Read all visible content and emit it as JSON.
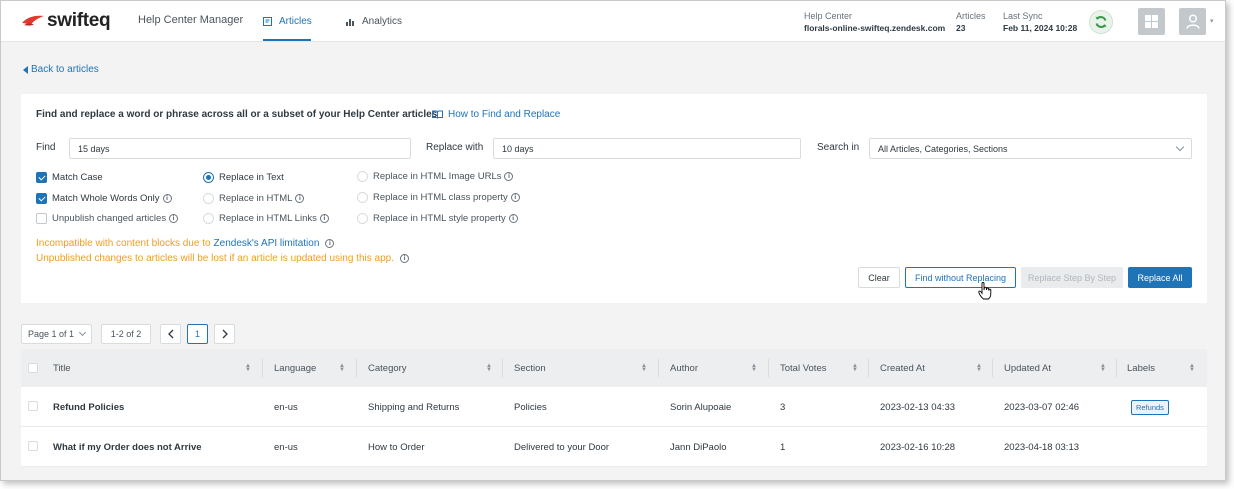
{
  "header": {
    "brand": "swifteq",
    "app_title": "Help Center Manager",
    "tabs": [
      {
        "label": "Articles",
        "icon": "article-icon",
        "active": true
      },
      {
        "label": "Analytics",
        "icon": "bar-chart-icon",
        "active": false
      }
    ],
    "help_center_label": "Help Center",
    "help_center_value": "florals-online-swifteq.zendesk.com",
    "articles_label": "Articles",
    "articles_value": "23",
    "last_sync_label": "Last Sync",
    "last_sync_value": "Feb 11, 2024 10:28"
  },
  "back_link": "Back to articles",
  "panel": {
    "heading": "Find and replace a word or phrase across all or a subset of your Help Center articles",
    "how_to_link": "How to Find and Replace",
    "find_label": "Find",
    "find_value": "15 days",
    "replace_label": "Replace with",
    "replace_value": "10 days",
    "search_in_label": "Search in",
    "search_in_value": "All Articles, Categories, Sections",
    "checkboxes": [
      {
        "label": "Match Case",
        "checked": true
      },
      {
        "label": "Match Whole Words Only",
        "checked": true
      },
      {
        "label": "Unpublish changed articles",
        "checked": false
      }
    ],
    "radios_col1": [
      {
        "label": "Replace in Text",
        "selected": true
      },
      {
        "label": "Replace in HTML",
        "selected": false
      },
      {
        "label": "Replace in HTML Links",
        "selected": false
      }
    ],
    "radios_col2": [
      {
        "label": "Replace in HTML Image URLs",
        "selected": false
      },
      {
        "label": "Replace in HTML class property",
        "selected": false
      },
      {
        "label": "Replace in HTML style property",
        "selected": false
      }
    ],
    "warning1_prefix": "Incompatible with content blocks due to",
    "warning1_link": "Zendesk's API limitation",
    "warning2": "Unpublished changes to articles will be lost if an article is updated using this app.",
    "buttons": {
      "clear": "Clear",
      "find_without_replacing": "Find without Replacing",
      "replace_step": "Replace Step By Step",
      "replace_all": "Replace All"
    }
  },
  "pagination": {
    "page_select": "Page 1 of 1",
    "range": "1-2 of 2",
    "current_page": "1"
  },
  "table": {
    "columns": [
      "Title",
      "Language",
      "Category",
      "Section",
      "Author",
      "Total Votes",
      "Created At",
      "Updated At",
      "Labels"
    ],
    "rows": [
      {
        "title": "Refund Policies",
        "language": "en-us",
        "category": "Shipping and Returns",
        "section": "Policies",
        "author": "Sorin Alupoaie",
        "votes": "3",
        "created": "2023-02-13 04:33",
        "updated": "2023-03-07 02:46",
        "label": "Refunds"
      },
      {
        "title": "What if my Order does not Arrive",
        "language": "en-us",
        "category": "How to Order",
        "section": "Delivered to your Door",
        "author": "Jann DiPaolo",
        "votes": "1",
        "created": "2023-02-16 10:28",
        "updated": "2023-04-18 03:13",
        "label": ""
      }
    ]
  },
  "colors": {
    "accent": "#1f73b7",
    "warning": "#ef9e22",
    "brand_red": "#e03a2f"
  }
}
